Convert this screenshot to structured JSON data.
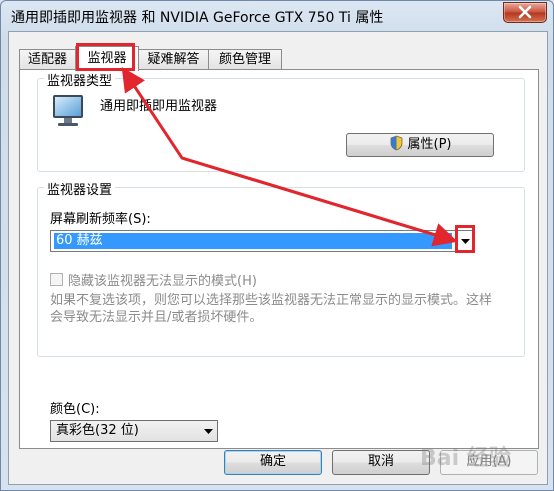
{
  "window": {
    "title": "通用即插即用监视器 和 NVIDIA GeForce GTX 750 Ti 属性"
  },
  "tabs": [
    {
      "label": "适配器"
    },
    {
      "label": "监视器",
      "active": true
    },
    {
      "label": "疑难解答"
    },
    {
      "label": "颜色管理"
    }
  ],
  "monitor_type": {
    "group_label": "监视器类型",
    "monitor_name": "通用即插即用监视器",
    "properties_button": "属性(P)"
  },
  "monitor_settings": {
    "group_label": "监视器设置",
    "refresh_label": "屏幕刷新频率(S):",
    "refresh_value": "60 赫兹",
    "hide_modes_label": "隐藏该监视器无法显示的模式(H)",
    "hide_modes_checked": false,
    "note": "如果不复选该项，则您可以选择那些该监视器无法正常显示的显示模式。这样会导致无法显示并且/或者损坏硬件。"
  },
  "color": {
    "label": "颜色(C):",
    "value": "真彩色(32 位)"
  },
  "buttons": {
    "ok": "确定",
    "cancel": "取消",
    "apply": "应用(A)"
  },
  "annotation_color": "#e2262d",
  "watermark": "Bai 经验"
}
